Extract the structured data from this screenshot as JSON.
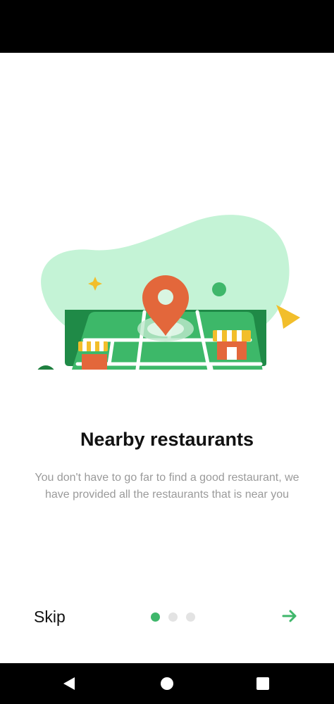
{
  "onboarding": {
    "title": "Nearby restaurants",
    "description": "You don't have to go far to find a good restaurant, we have provided all the restaurants that is near you",
    "skip_label": "Skip",
    "page_indicator": {
      "total": 3,
      "active": 1
    },
    "next_icon": "arrow-right-icon"
  },
  "illustration": {
    "icon": "map-with-location-pin-illustration"
  },
  "system_nav": {
    "back_icon": "back-triangle-icon",
    "home_icon": "home-circle-icon",
    "recents_icon": "recents-square-icon"
  },
  "colors": {
    "accent": "#3fb76b",
    "map_green": "#2fb061",
    "pin_orange": "#e3673b",
    "blob": "#c4f3d6"
  }
}
